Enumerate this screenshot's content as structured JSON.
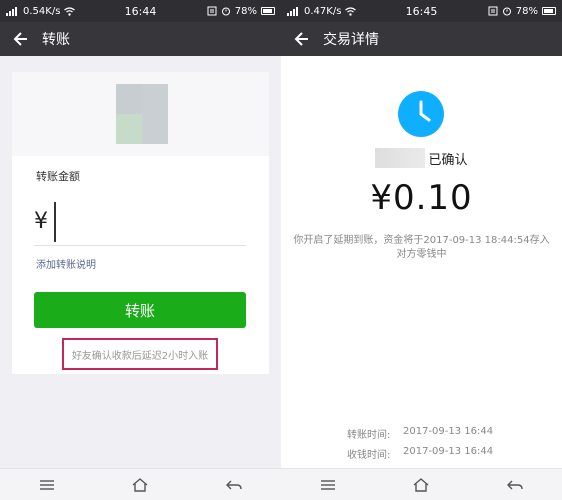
{
  "left_screen": {
    "status": {
      "speed": "0.54K/s",
      "time": "16:44",
      "battery": "78%"
    },
    "nav": {
      "title": "转账"
    },
    "form": {
      "amount_label": "转账金额",
      "currency": "¥",
      "amount_value": "",
      "add_note_link": "添加转账说明",
      "transfer_button": "转账",
      "delay_note": "好友确认收款后延迟2小时入账"
    }
  },
  "right_screen": {
    "status": {
      "speed": "0.47K/s",
      "time": "16:45",
      "battery": "78%"
    },
    "nav": {
      "title": "交易详情"
    },
    "detail": {
      "confirm_status": "已确认",
      "amount": "¥0.10",
      "defer_text": "你开启了延期到账，资金将于2017-09-13 18:44:54存入对方零钱中",
      "transfer_time_label": "转账时间:",
      "transfer_time": "2017-09-13 16:44",
      "receive_time_label": "收钱时间:",
      "receive_time": "2017-09-13 16:44"
    }
  },
  "colors": {
    "primary_green": "#1aad19",
    "link_blue": "#576b95",
    "clock_blue": "#10aeff",
    "highlight_red": "#c7255e"
  }
}
